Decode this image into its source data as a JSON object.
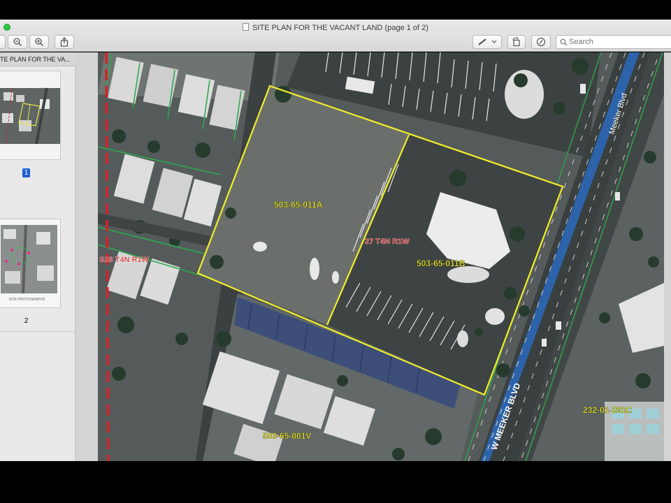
{
  "window": {
    "title": "SITE PLAN FOR THE VACANT LAND (page 1 of 2)"
  },
  "toolbar": {
    "search_placeholder": "Search",
    "buttons": [
      "sidebar-toggle",
      "zoom-out",
      "zoom-in",
      "share",
      "markup",
      "rotate",
      "annotate"
    ]
  },
  "sidebar": {
    "header": "TE PLAN FOR THE VA...",
    "pages": [
      {
        "number": "1",
        "selected": true
      },
      {
        "number": "2",
        "selected": false
      }
    ],
    "thumb2_caption": "SITE PHOTOGRAPHS"
  },
  "map": {
    "labels": {
      "parcel_a": "503-65-011A",
      "parcel_b": "503-65-011B",
      "parcel_c": "503-65-001V",
      "parcel_d": "232-01-281C",
      "section_left": "S28 T4N R1W",
      "section_right": "27 T4N R1W",
      "street_main": "W MEEKER BLVD",
      "street_side": "Meeker Blvd"
    },
    "colors": {
      "parcel_outline": "#f2ee2a",
      "section_line": "#d8202a",
      "lot_line": "#2fa84f",
      "label_text": "#f4ef22",
      "section_label_text": "#d42020"
    }
  }
}
